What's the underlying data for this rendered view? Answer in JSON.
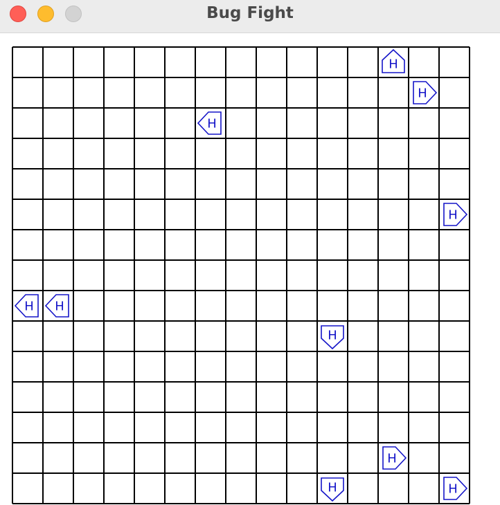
{
  "window": {
    "title": "Bug Fight",
    "buttons": {
      "close": "close",
      "minimize": "minimize",
      "zoom": "zoom"
    }
  },
  "grid": {
    "columns": 15,
    "rows": 15,
    "line_color": "#000000",
    "background": "#ffffff"
  },
  "bug_style": {
    "label": "H",
    "color": "#1414c8"
  },
  "bugs": [
    {
      "row": 0,
      "col": 12,
      "facing": "up"
    },
    {
      "row": 1,
      "col": 13,
      "facing": "right"
    },
    {
      "row": 2,
      "col": 6,
      "facing": "left"
    },
    {
      "row": 5,
      "col": 14,
      "facing": "right"
    },
    {
      "row": 8,
      "col": 0,
      "facing": "left"
    },
    {
      "row": 8,
      "col": 1,
      "facing": "left"
    },
    {
      "row": 9,
      "col": 10,
      "facing": "down"
    },
    {
      "row": 13,
      "col": 12,
      "facing": "right"
    },
    {
      "row": 14,
      "col": 10,
      "facing": "down"
    },
    {
      "row": 14,
      "col": 14,
      "facing": "right"
    }
  ]
}
